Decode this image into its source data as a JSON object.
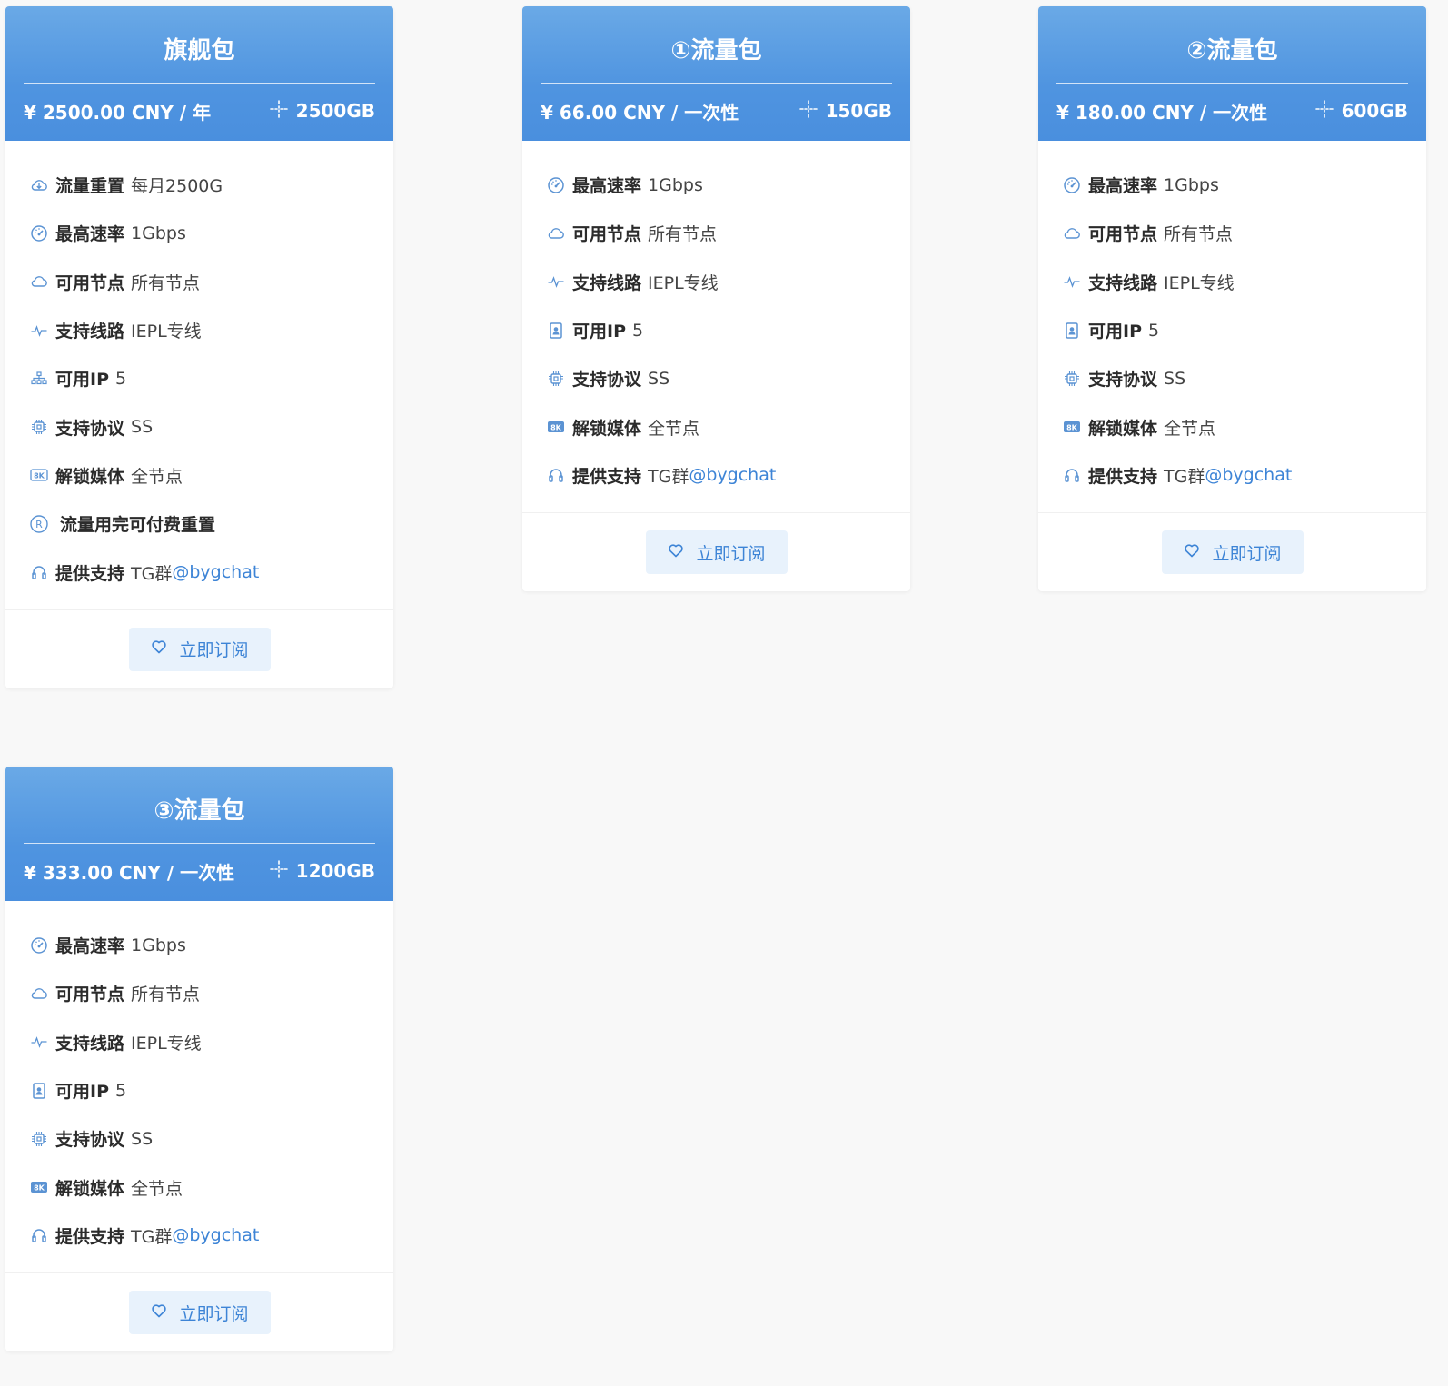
{
  "colors": {
    "header_gradient_top": "#6aa9e6",
    "header_gradient_bottom": "#4a8fde",
    "link": "#3d84d6",
    "button_bg": "#e8f2fc",
    "page_bg": "#f8f8f8"
  },
  "subscribe_label": "立即订阅",
  "plans": [
    {
      "title": "旗舰包",
      "price": "¥ 2500.00 CNY / 年",
      "quota": "2500GB",
      "features": [
        {
          "icon": "cloud-download-icon",
          "key": "流量重置",
          "value": "每月2500G"
        },
        {
          "icon": "speedometer-icon",
          "key": "最高速率",
          "value": "1Gbps"
        },
        {
          "icon": "cloud-icon",
          "key": "可用节点",
          "value": "所有节点"
        },
        {
          "icon": "pulse-icon",
          "key": "支持线路",
          "value": "IEPL专线"
        },
        {
          "icon": "network-icon",
          "key": "可用IP",
          "value": "5"
        },
        {
          "icon": "chip-icon",
          "key": "支持协议",
          "value": "SS"
        },
        {
          "icon": "8k-icon",
          "key": "解锁媒体",
          "value": "全节点"
        },
        {
          "icon": "registered-icon",
          "key": "流量用完可付费重置",
          "value": ""
        },
        {
          "icon": "headset-icon",
          "key": "提供支持",
          "value": "TG群",
          "link": "@bygchat"
        }
      ]
    },
    {
      "title": "①流量包",
      "price": "¥ 66.00 CNY / 一次性",
      "quota": "150GB",
      "features": [
        {
          "icon": "speedometer-icon",
          "key": "最高速率",
          "value": "1Gbps"
        },
        {
          "icon": "cloud-icon",
          "key": "可用节点",
          "value": "所有节点"
        },
        {
          "icon": "pulse-icon",
          "key": "支持线路",
          "value": "IEPL专线"
        },
        {
          "icon": "id-card-icon",
          "key": "可用IP",
          "value": "5"
        },
        {
          "icon": "chip-icon",
          "key": "支持协议",
          "value": "SS"
        },
        {
          "icon": "8k-filled-icon",
          "key": "解锁媒体",
          "value": "全节点"
        },
        {
          "icon": "headset-icon",
          "key": "提供支持",
          "value": "TG群",
          "link": "@bygchat"
        }
      ]
    },
    {
      "title": "②流量包",
      "price": "¥ 180.00 CNY / 一次性",
      "quota": "600GB",
      "features": [
        {
          "icon": "speedometer-icon",
          "key": "最高速率",
          "value": "1Gbps"
        },
        {
          "icon": "cloud-icon",
          "key": "可用节点",
          "value": "所有节点"
        },
        {
          "icon": "pulse-icon",
          "key": "支持线路",
          "value": "IEPL专线"
        },
        {
          "icon": "id-card-icon",
          "key": "可用IP",
          "value": "5"
        },
        {
          "icon": "chip-icon",
          "key": "支持协议",
          "value": "SS"
        },
        {
          "icon": "8k-filled-icon",
          "key": "解锁媒体",
          "value": "全节点"
        },
        {
          "icon": "headset-icon",
          "key": "提供支持",
          "value": "TG群",
          "link": "@bygchat"
        }
      ]
    },
    {
      "title": "③流量包",
      "price": "¥ 333.00 CNY / 一次性",
      "quota": "1200GB",
      "features": [
        {
          "icon": "speedometer-icon",
          "key": "最高速率",
          "value": "1Gbps"
        },
        {
          "icon": "cloud-icon",
          "key": "可用节点",
          "value": "所有节点"
        },
        {
          "icon": "pulse-icon",
          "key": "支持线路",
          "value": "IEPL专线"
        },
        {
          "icon": "id-card-icon",
          "key": "可用IP",
          "value": "5"
        },
        {
          "icon": "chip-icon",
          "key": "支持协议",
          "value": "SS"
        },
        {
          "icon": "8k-filled-icon",
          "key": "解锁媒体",
          "value": "全节点"
        },
        {
          "icon": "headset-icon",
          "key": "提供支持",
          "value": "TG群",
          "link": "@bygchat"
        }
      ]
    }
  ]
}
